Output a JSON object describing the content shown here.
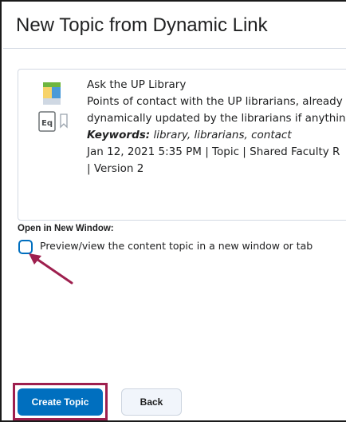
{
  "page": {
    "title": "New Topic from Dynamic Link"
  },
  "card": {
    "name": "Ask the UP Library",
    "description_line1": "Points of contact with the UP librarians, already",
    "description_line2": "dynamically updated by the librarians if anythin",
    "keywords_label": "Keywords:",
    "keywords": "library, librarians, contact",
    "meta_line1": "Jan 12, 2021 5:35 PM | Topic | Shared Faculty R",
    "meta_line2": "| Version 2"
  },
  "options": {
    "section_label": "Open in New Window:",
    "checkbox_label": "Preview/view the content topic in a new window or tab",
    "checked": false
  },
  "buttons": {
    "create_label": "Create Topic",
    "back_label": "Back"
  },
  "colors": {
    "primary": "#006fbf",
    "highlight": "#9e1f4e",
    "arrow": "#9e1f4e"
  }
}
